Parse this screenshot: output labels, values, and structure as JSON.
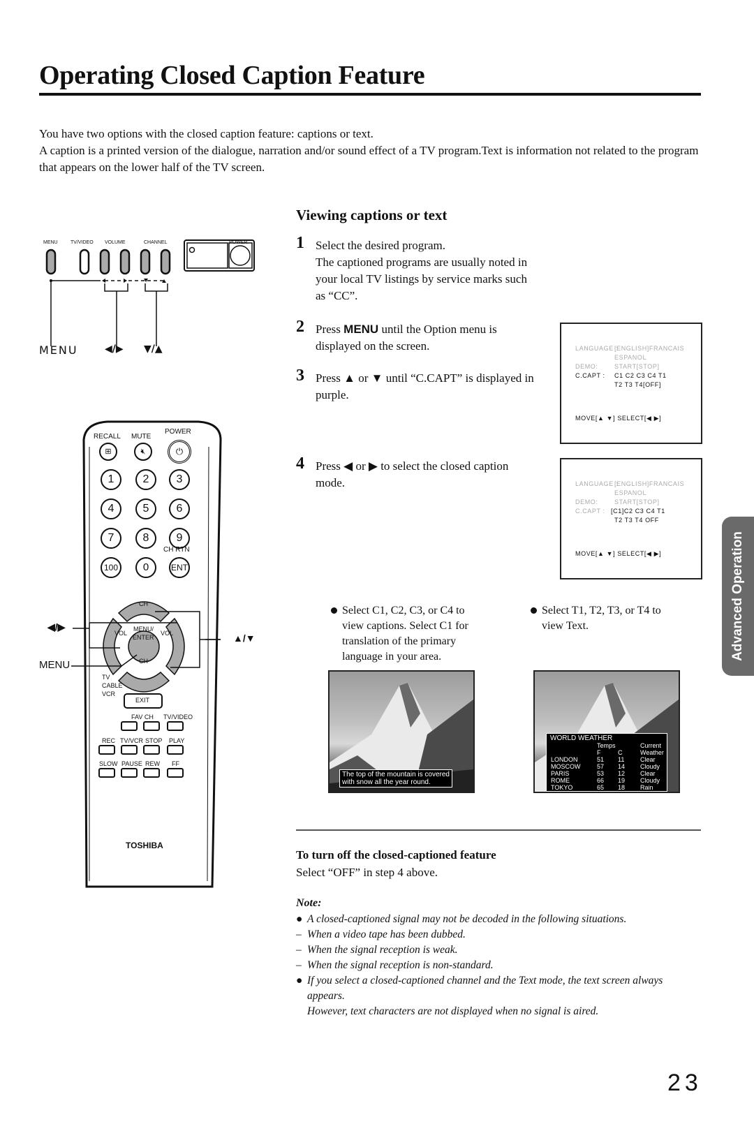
{
  "page": {
    "title": "Operating Closed Caption Feature",
    "intro": [
      "You have two options with the closed caption feature: captions or text.",
      "A caption is a printed version of the dialogue, narration and/or sound effect of a TV program.Text is information not related to the program that appears on the lower half of the TV screen."
    ],
    "page_number": "23",
    "side_tab": "Advanced Operation"
  },
  "tv_panel": {
    "labels": {
      "menu": "MENU",
      "tv_video": "TV/VIDEO",
      "volume": "VOLUME",
      "channel": "CHANNEL",
      "power": "POWER"
    },
    "callouts": {
      "menu": "MENU",
      "left_right": "◀/▶",
      "down_up": "▼/▲"
    }
  },
  "remote": {
    "top_labels": {
      "recall": "RECALL",
      "mute": "MUTE",
      "power": "POWER"
    },
    "digits": [
      "1",
      "2",
      "3",
      "4",
      "5",
      "6",
      "7",
      "8",
      "9"
    ],
    "ch_rtn": "CH RTN",
    "bottom_row": [
      "100",
      "0",
      "ENT"
    ],
    "dpad": {
      "ch_up": "CH",
      "ch_down": "CH",
      "vol_left": "VOL",
      "vol_right": "VOL",
      "center_line1": "MENU/",
      "center_line2": "ENTER"
    },
    "callouts": {
      "left_right": "◀/▶",
      "up_down": "▲/▼",
      "menu": "MENU"
    },
    "modes": [
      "TV",
      "CABLE",
      "VCR"
    ],
    "exit": "EXIT",
    "row1_labels": [
      "FAV CH",
      "TV/VIDEO"
    ],
    "row2_labels": [
      "REC",
      "TV/VCR",
      "STOP",
      "PLAY"
    ],
    "row3_labels": [
      "SLOW",
      "PAUSE",
      "REW",
      "FF"
    ],
    "brand": "TOSHIBA"
  },
  "section": {
    "title": "Viewing captions or text",
    "steps": [
      {
        "num": "1",
        "text": "Select the desired program.",
        "text2": "The captioned programs are usually noted in your local TV listings by service marks such as “CC”."
      },
      {
        "num": "2",
        "pre": "Press ",
        "kw": "MENU",
        "post": " until the Option menu is displayed on the screen."
      },
      {
        "num": "3",
        "text": "Press ▲ or ▼ until “C.CAPT” is displayed in purple."
      },
      {
        "num": "4",
        "text": "Press ◀ or ▶ to select the closed caption mode."
      }
    ]
  },
  "osd1": {
    "language_label": "LANGUAGE :",
    "language_value": "[ENGLISH]FRANCAIS",
    "language_value2": "ESPANOL",
    "demo_label": "DEMO:",
    "demo_value": "START[STOP]",
    "ccapt_label": "C.CAPT :",
    "ccapt_value": "C1 C2 C3 C4 T1",
    "ccapt_value2": "T2 T3 T4[OFF]",
    "footer": "MOVE[▲ ▼] SELECT[◀ ▶]"
  },
  "osd2": {
    "language_label": "LANGUAGE :",
    "language_value": "[ENGLISH]FRANCAIS",
    "language_value2": "ESPANOL",
    "demo_label": "DEMO:",
    "demo_value": "START[STOP]",
    "ccapt_label": "C.CAPT :",
    "ccapt_value": "[C1]C2 C3 C4 T1",
    "ccapt_value2": "T2 T3 T4 OFF",
    "footer": "MOVE[▲ ▼] SELECT[◀ ▶]"
  },
  "bullets": {
    "captions": "Select C1, C2, C3, or C4 to view captions. Select C1 for translation of the primary language in your area.",
    "text": "Select T1, T2, T3, or T4 to view Text."
  },
  "caption_screen": {
    "caption_line1": "The top of the mountain is covered",
    "caption_line2": "with snow all the year round."
  },
  "text_screen": {
    "title": "WORLD WEATHER",
    "header1": [
      "",
      "Temps",
      "",
      "Current"
    ],
    "header2": [
      "",
      "F",
      "C",
      "Weather"
    ],
    "rows": [
      [
        "LONDON",
        "51",
        "11",
        "Clear"
      ],
      [
        "MOSCOW",
        "57",
        "14",
        "Cloudy"
      ],
      [
        "PARIS",
        "53",
        "12",
        "Clear"
      ],
      [
        "ROME",
        "66",
        "19",
        "Cloudy"
      ],
      [
        "TOKYO",
        "65",
        "18",
        "Rain"
      ]
    ]
  },
  "turn_off": {
    "title": "To turn off the closed-captioned feature",
    "text": "Select “OFF” in step 4 above."
  },
  "note": {
    "title": "Note:",
    "items": [
      {
        "mark": "●",
        "text": "A closed-captioned signal may not be decoded in the following situations."
      },
      {
        "mark": "–",
        "text": "When a video tape has been dubbed."
      },
      {
        "mark": "–",
        "text": "When the signal reception is weak."
      },
      {
        "mark": "–",
        "text": "When the signal reception is non-standard."
      },
      {
        "mark": "●",
        "text": "If you select a closed-captioned channel and the Text mode, the text screen always appears."
      },
      {
        "mark": "",
        "text": "However, text characters are not displayed when no signal is aired."
      }
    ]
  }
}
